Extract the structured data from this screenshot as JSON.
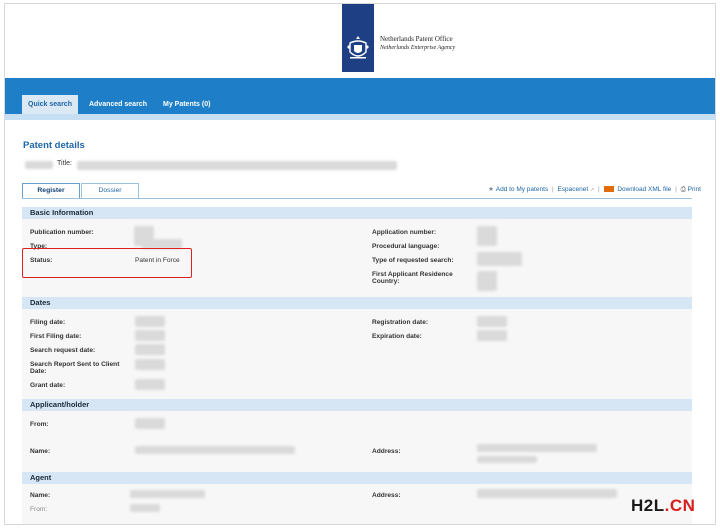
{
  "header": {
    "org_name": "Netherlands Patent Office",
    "org_sub": "Netherlands Enterprise Agency"
  },
  "nav": {
    "items": [
      {
        "label": "Quick search",
        "active": true
      },
      {
        "label": "Advanced search",
        "active": false
      },
      {
        "label": "My Patents (0)",
        "active": false
      }
    ]
  },
  "page": {
    "title": "Patent details",
    "title_label": "Title:"
  },
  "tabs": [
    {
      "label": "Register",
      "active": true
    },
    {
      "label": "Dossier",
      "active": false
    }
  ],
  "actions": {
    "add_to_my_patents": "Add to My patents",
    "espacenet": "Espacenet",
    "download_xml": "Download XML file",
    "print": "Print"
  },
  "basic": {
    "heading": "Basic Information",
    "publication_number": "Publication number:",
    "type": "Type:",
    "status": "Status:",
    "status_value": "Patent in Force",
    "application_number": "Application number:",
    "procedural_language": "Procedural language:",
    "type_of_requested_search": "Type of requested search:",
    "first_applicant_residence_country": "First Applicant Residence Country:"
  },
  "dates": {
    "heading": "Dates",
    "filing_date": "Filing date:",
    "first_filing_date": "First Filing date:",
    "search_request_date": "Search request date:",
    "search_report_sent": "Search Report Sent to Client Date:",
    "grant_date": "Grant date:",
    "registration_date": "Registration date:",
    "expiration_date": "Expiration date:"
  },
  "applicant": {
    "heading": "Applicant/holder",
    "from": "From:",
    "name": "Name:",
    "address": "Address:"
  },
  "agent": {
    "heading": "Agent",
    "name": "Name:",
    "address": "Address:",
    "from": "From:"
  },
  "watermark": {
    "left": "H2L",
    "right": ".CN"
  },
  "colors": {
    "brand_blue": "#1e7fc8",
    "section_head": "#d6e6f4",
    "highlight_red": "#e02020"
  }
}
